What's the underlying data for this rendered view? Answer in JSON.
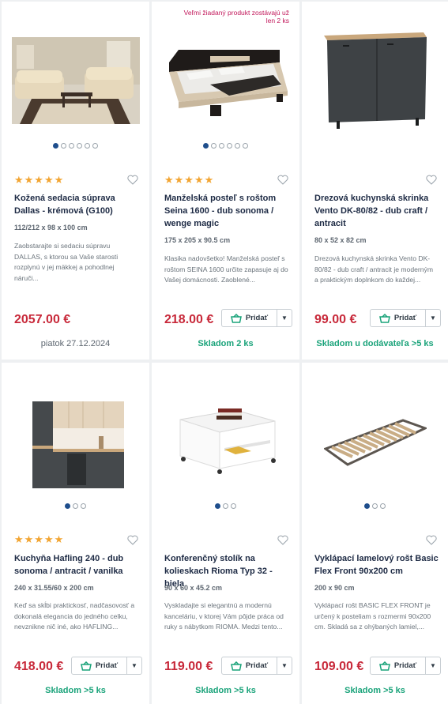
{
  "products": [
    {
      "badge": "",
      "rating_stars": 5,
      "title": "Kožená sedacia súprava Dallas - krémová (G100)",
      "dimensions": "112/212 x 98 x 100 cm",
      "description": "Zaobstarajte si sedaciu súpravu DALLAS, s ktorou sa Vaše starosti rozplynú v jej mäkkej a pohodlnej náruči...",
      "price": "2057.00 €",
      "add_label": "",
      "availability": "",
      "delivery": "piatok 27.12.2024",
      "image_icon": "sofa-set-icon",
      "dots_total": 6,
      "dot_active": 0
    },
    {
      "badge": "Veľmi žiadaný produkt zostávajú už len 2 ks",
      "rating_stars": 5,
      "title": "Manželská posteľ s roštom Seina 1600 - dub sonoma / wenge magic",
      "dimensions": "175 x 205 x 90.5 cm",
      "description": "Klasika nadovšetko! Manželská posteľ s roštom SEINA 1600 určite zapasuje aj do Vašej domácnosti. Zaoblené...",
      "price": "218.00 €",
      "add_label": "Pridať",
      "availability": "Skladom 2 ks",
      "delivery": "",
      "image_icon": "bed-icon",
      "dots_total": 6,
      "dot_active": 0
    },
    {
      "badge": "",
      "rating_stars": 0,
      "title": "Drezová kuchynská skrinka Vento DK-80/82 - dub craft / antracit",
      "dimensions": "80 x 52 x 82 cm",
      "description": "Drezová kuchynská skrinka Vento DK-80/82 - dub craft / antracit je moderným a praktickým doplnkom do každej...",
      "price": "99.00 €",
      "add_label": "Pridať",
      "availability": "Skladom u dodávateľa >5 ks",
      "delivery": "",
      "image_icon": "kitchen-cabinet-icon",
      "dots_total": 0,
      "dot_active": 0
    },
    {
      "badge": "",
      "rating_stars": 5,
      "title": "Kuchyňa Hafling 240 - dub sonoma / antracit / vanilka",
      "dimensions": "240 x 31.55/60 x 200 cm",
      "description": "Keď sa skĺbi praktickosť, nadčasovosť a dokonalá elegancia do jedného celku, nevznikne nič iné, ako HAFLING...",
      "price": "418.00 €",
      "add_label": "Pridať",
      "availability": "Skladom >5 ks",
      "delivery": "",
      "image_icon": "kitchen-set-icon",
      "dots_total": 3,
      "dot_active": 0
    },
    {
      "badge": "",
      "rating_stars": 0,
      "title": "Konferenčný stolík na kolieskach Rioma Typ 32 - biela",
      "dimensions": "90 x 60 x 45.2 cm",
      "description": "Vyskladajte si elegantnú a modernú kanceláriu, v ktorej Vám pôjde práca od ruky s nábytkom RIOMA. Medzi tento...",
      "price": "119.00 €",
      "add_label": "Pridať",
      "availability": "Skladom >5 ks",
      "delivery": "",
      "image_icon": "coffee-table-icon",
      "dots_total": 3,
      "dot_active": 0
    },
    {
      "badge": "",
      "rating_stars": 0,
      "title": "Vyklápací lamelový rošt Basic Flex Front 90x200 cm",
      "dimensions": "200 x 90 cm",
      "description": "Vyklápací rošt BASIC FLEX FRONT je určený k posteliam s rozmermi 90x200 cm. Skladá sa z ohýbaných lamiel,...",
      "price": "109.00 €",
      "add_label": "Pridať",
      "availability": "Skladom >5 ks",
      "delivery": "",
      "image_icon": "slatted-bed-base-icon",
      "dots_total": 3,
      "dot_active": 0
    }
  ],
  "colors": {
    "price": "#c8293a",
    "stock": "#1aa37a",
    "stars": "#f2a532",
    "dot_active": "#1f4e8c",
    "badge": "#c2185b"
  }
}
